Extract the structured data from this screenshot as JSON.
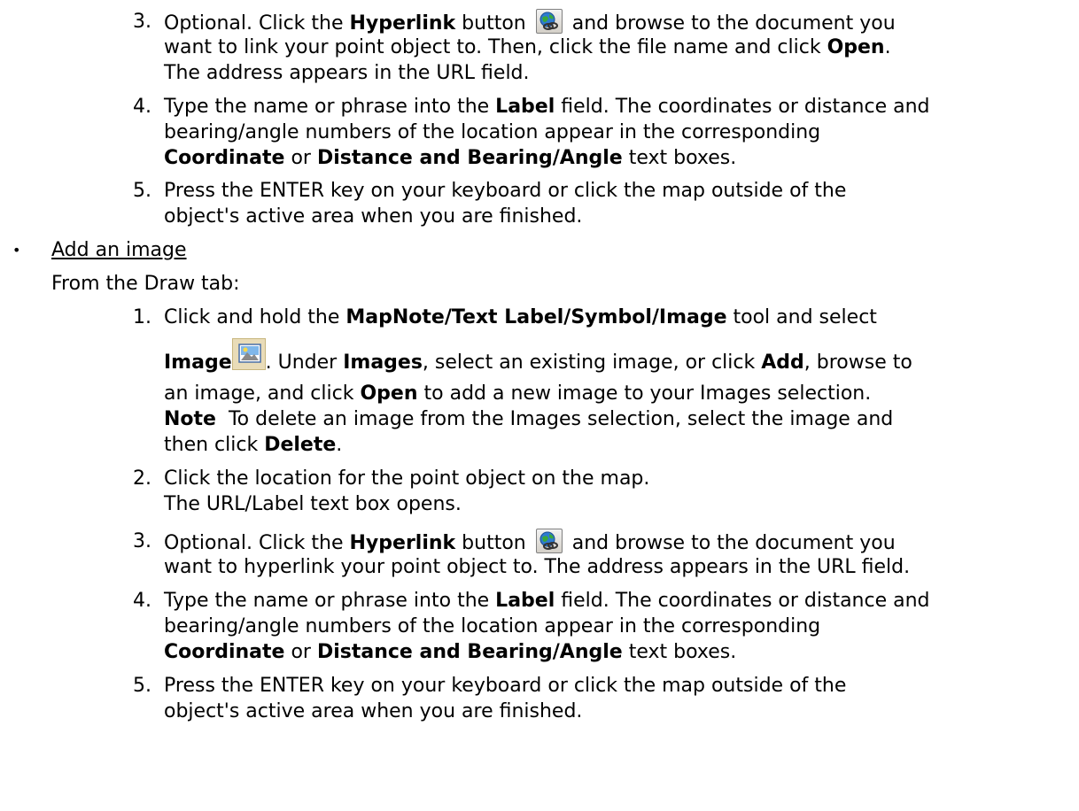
{
  "item3": {
    "num": "3.",
    "l1_a": "Optional. Click the ",
    "l1_b": "Hyperlink",
    "l1_c": " button ",
    "l1_d": " and browse to the document you",
    "l2_a": "want to link your point object to. Then, click the file name and click ",
    "l2_b": "Open",
    "l2_c": ".",
    "l3": "The address appears in the URL field."
  },
  "item4": {
    "num": "4.",
    "l1_a": "Type the name or phrase into the ",
    "l1_b": "Label",
    "l1_c": " field. The coordinates or distance and",
    "l2": "bearing/angle numbers of the location appear in the corresponding",
    "l3_a": "Coordinate",
    "l3_b": " or ",
    "l3_c": "Distance and Bearing/Angle",
    "l3_d": " text boxes."
  },
  "item5": {
    "num": "5.",
    "l1": "Press the ENTER key on your keyboard or click the map outside of the",
    "l2": "object's active area when you are finished."
  },
  "bullet": {
    "symbol": "•",
    "link": "Add an image",
    "from": "From the Draw tab:"
  },
  "img_item1": {
    "num": "1.",
    "l1_a": "Click and hold the ",
    "l1_b": "MapNote/Text Label/Symbol/Image",
    "l1_c": " tool and select",
    "l2_a": "Image",
    "l2_b": ". Under ",
    "l2_c": "Images",
    "l2_d": ", select an existing image, or click ",
    "l2_e": "Add",
    "l2_f": ", browse to",
    "l3_a": "an image, and click ",
    "l3_b": "Open",
    "l3_c": " to add a new image to your Images selection.",
    "l4_a": "Note",
    "l4_b": "  To delete an image from the Images selection, select the image and",
    "l5_a": "then click ",
    "l5_b": "Delete",
    "l5_c": "."
  },
  "img_item2": {
    "num": "2.",
    "l1": "Click the location for the point object on the map.",
    "l2": "The URL/Label text box opens."
  },
  "img_item3": {
    "num": "3.",
    "l1_a": "Optional. Click the ",
    "l1_b": "Hyperlink",
    "l1_c": " button ",
    "l1_d": " and browse to the document you",
    "l2": "want to hyperlink your point object to. The address appears in the URL field."
  },
  "img_item4": {
    "num": "4.",
    "l1_a": "Type the name or phrase into the ",
    "l1_b": "Label",
    "l1_c": " field. The coordinates or distance and",
    "l2": "bearing/angle numbers of the location appear in the corresponding",
    "l3_a": "Coordinate",
    "l3_b": " or ",
    "l3_c": "Distance and Bearing/Angle",
    "l3_d": " text boxes."
  },
  "img_item5": {
    "num": "5.",
    "l1": "Press the ENTER key on your keyboard or click the map outside of the",
    "l2": "object's active area when you are finished."
  },
  "icons": {
    "hyperlink": "hyperlink-globe-icon",
    "image": "image-tool-icon"
  }
}
